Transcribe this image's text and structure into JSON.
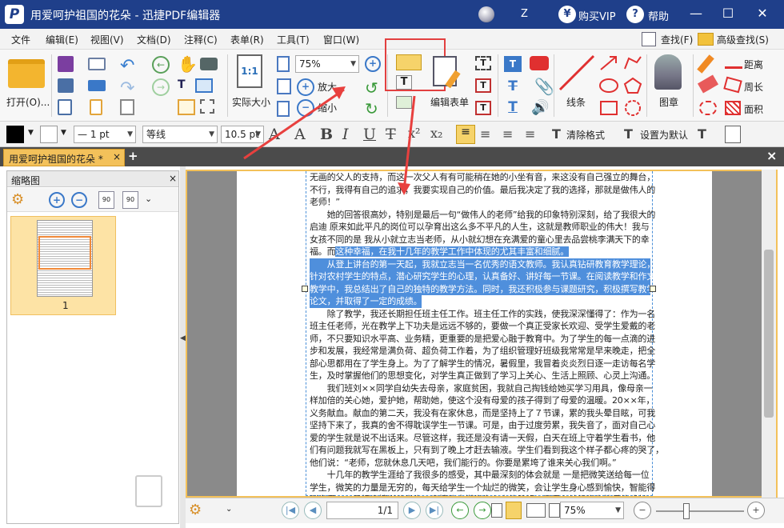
{
  "window": {
    "title": "用爱呵护祖国的花朵 - 迅捷PDF编辑器",
    "user_initial": "Z",
    "buy_vip": "购买VIP",
    "help": "帮助",
    "minimize": "—",
    "maximize": "☐",
    "close": "✕"
  },
  "menu": [
    "文件",
    "编辑(E)",
    "视图(V)",
    "文档(D)",
    "注释(C)",
    "表单(R)",
    "工具(T)",
    "窗口(W)"
  ],
  "menu_right": {
    "find": "查找(F)",
    "advanced_find": "高级查找(S)"
  },
  "toolbar": {
    "open": "打开(O)...",
    "actual_size": "实际大小",
    "zoom_value": "75%",
    "zoom_in": "放大",
    "zoom_out": "缩小",
    "edit_form": "编辑表单",
    "line_tool": "线条",
    "stamp": "图章",
    "distance": "距离",
    "perimeter": "周长",
    "area": "面积",
    "actual_size_icon_text": "1:1"
  },
  "format": {
    "font": "等线",
    "font_size": "10.5 pt",
    "line_width": "— 1 pt",
    "clear_format": "清除格式",
    "set_default": "设置为默认"
  },
  "tabs": {
    "doc_tab": "用爱呵护祖国的花朵 *",
    "close": "×",
    "add": "+"
  },
  "thumbnails": {
    "title": "缩略图",
    "close": "×",
    "page_label": "1"
  },
  "document_lines": [
    {
      "text": "无画的父人的支持，而这一次父人有有可能稍在她的小坐有音，来这没有自己强立的舞台，",
      "hl": false
    },
    {
      "text": "不行，我得有自己的追求，我要实现自己的价值。最后我决定了我的选择，那就是做伟人的",
      "hl": false
    },
    {
      "text": "老师！”",
      "hl": false
    },
    {
      "text": "　　她的回答很高妙，特别是最后一句“做伟人的老师”给我的印象特别深刻，给了我很大的",
      "hl": false
    },
    {
      "text": "启迪  原来如此平凡的岗位可以孕育出这么多不平凡的人生，这就是教师职业的伟大！我与",
      "hl": false
    },
    {
      "text": "女孩不同的是  我从小就立志当老师，从小就幻想在充满爱的童心里去品尝桃李满天下的幸",
      "hl": false
    },
    {
      "text": "福。而这种幸福，在我十几年的教学工作中体现的尤其丰富和细腻。",
      "hl": "partial"
    },
    {
      "text": "　　从登上讲台的第一天起，我就立志当一名优秀的语文教师。我认真钻研教育教学理论，",
      "hl": true
    },
    {
      "text": "针对农村学生的特点，潜心研究学生的心理，认真备好、讲好每一节课。在阅读教学和作文",
      "hl": true
    },
    {
      "text": "教学中，我总结出了自己的独特的教学方法。同时，我还积极参与课题研究，积极撰写教学",
      "hl": true
    },
    {
      "text": "论文，并取得了一定的成绩。",
      "hl": "short"
    },
    {
      "text": "　　除了教学，我还长期担任班主任工作。班主任工作的实践，使我深深懂得了：作为一名",
      "hl": false
    },
    {
      "text": "班主任老师，光在教学上下功夫是远远不够的，要做一个真正受家长欢迎、受学生爱戴的老",
      "hl": false
    },
    {
      "text": "师，不只要知识水平高、业务精，更重要的是把爱心融于教育中。为了学生的每一点滴的进",
      "hl": false
    },
    {
      "text": "步和发展，我经常是满负荷、超负荷工作着，为了组织管理好班级我常常是早来晚走，把全",
      "hl": false
    },
    {
      "text": "部心思都用在了学生身上。为了了解学生的情况，暑假里，我冒着炎炎烈日逐一走访每名学",
      "hl": false
    },
    {
      "text": "生，及时掌握他们的思想变化，对学生真正做到了学习上关心、生活上照顾、心灵上沟通。",
      "hl": false
    },
    {
      "text": "　　我们班刘××同学自幼失去母亲，家庭贫困，我就自己掏钱给她买学习用具，像母亲一",
      "hl": false
    },
    {
      "text": "样加倍的关心她，爱护她，帮助她，使这个没有母爱的孩子得到了母爱的温暖。20××年，",
      "hl": false
    },
    {
      "text": "义务献血。献血的第二天，我没有在家休息，而是坚持上了７节课，累的我头晕目眩，可我",
      "hl": false
    },
    {
      "text": "坚持下来了，我真的舍不得耽误学生一节课。可是，由于过度劳累，我失音了，面对自己心",
      "hl": false
    },
    {
      "text": "爱的学生就是说不出话来。尽管这样，我还是没有请一天假，白天在班上守着学生看书，他",
      "hl": false
    },
    {
      "text": "们有问题我就写在黑板上，只有到了晚上才赶去输液。学生们看到我这个样子都心疼的哭了，",
      "hl": false
    },
    {
      "text": "他们说：“老师，您就休息几天吧，我们能行的。你要是累垮了谁来关心我们啊。”",
      "hl": false
    },
    {
      "text": "　　十几年的教学生涯给了我很多的感受，其中最深刻的体会就是 一是把微笑送给每一位",
      "hl": false
    },
    {
      "text": "学生，微笑的力量是无穷的，每天给学生一个灿烂的微笑，会让学生身心感到愉快，智能得",
      "hl": false
    },
    {
      "text": "到发展，二是把真情送给学生，真情能点燃学生心中的希望，用爱心编织学生快乐的成长。",
      "hl": false
    }
  ],
  "status": {
    "page_display": "1/1",
    "zoom_value": "75%"
  }
}
